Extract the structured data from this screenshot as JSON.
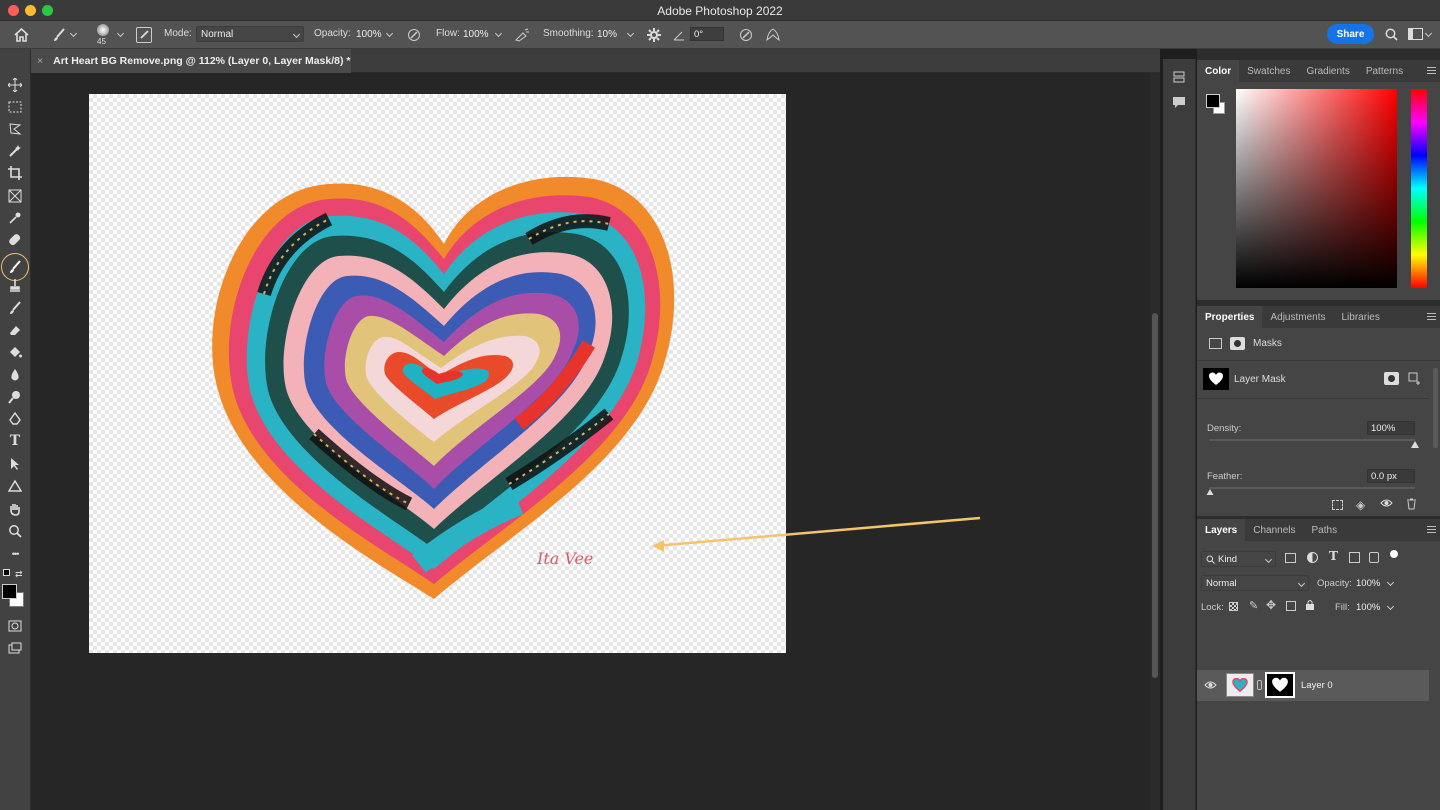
{
  "app": {
    "title": "Adobe Photoshop 2022"
  },
  "options_bar": {
    "brush_size": "45",
    "mode_label": "Mode:",
    "mode_value": "Normal",
    "opacity_label": "Opacity:",
    "opacity_value": "100%",
    "flow_label": "Flow:",
    "flow_value": "100%",
    "smoothing_label": "Smoothing:",
    "smoothing_value": "10%",
    "angle_value": "0°",
    "share_label": "Share"
  },
  "document": {
    "tab_title": "Art Heart BG Remove.png @ 112% (Layer 0, Layer Mask/8) *",
    "close_symbol": "×"
  },
  "toolbar": {
    "type_tool_glyph": "T",
    "more_glyph": "•••"
  },
  "color_panel": {
    "tabs": [
      "Color",
      "Swatches",
      "Gradients",
      "Patterns"
    ]
  },
  "properties_panel": {
    "tabs": [
      "Properties",
      "Adjustments",
      "Libraries"
    ],
    "masks_label": "Masks",
    "layer_mask_label": "Layer Mask",
    "density_label": "Density:",
    "density_value": "100%",
    "feather_label": "Feather:",
    "feather_value": "0.0 px"
  },
  "layers_panel": {
    "tabs": [
      "Layers",
      "Channels",
      "Paths"
    ],
    "filter_label": "Kind",
    "blend_mode": "Normal",
    "opacity_label": "Opacity:",
    "opacity_value": "100%",
    "lock_label": "Lock:",
    "fill_label": "Fill:",
    "fill_value": "100%",
    "layers": [
      {
        "name": "Layer 0"
      }
    ]
  },
  "artwork": {
    "signature": "Ita Vee"
  },
  "colors": {
    "accent": "#1473e6",
    "highlight_ring": "#e8c46a",
    "arrow": "#f2c46b"
  }
}
